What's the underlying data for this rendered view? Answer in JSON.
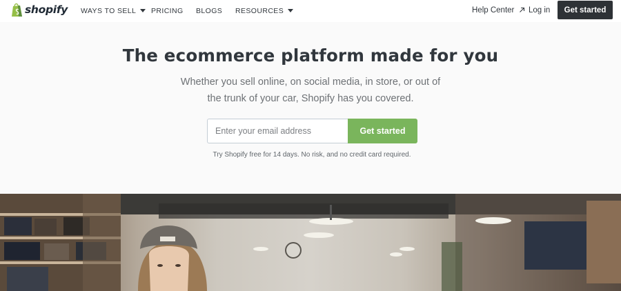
{
  "brand": {
    "name": "shopify"
  },
  "nav": {
    "items": [
      {
        "label": "WAYS TO SELL",
        "has_dropdown": true
      },
      {
        "label": "PRICING",
        "has_dropdown": false
      },
      {
        "label": "BLOGS",
        "has_dropdown": false
      },
      {
        "label": "RESOURCES",
        "has_dropdown": true
      }
    ],
    "help_center": "Help Center",
    "login": "Log in",
    "cta": "Get started"
  },
  "hero": {
    "title": "The ecommerce platform made for you",
    "subtitle": "Whether you sell online, on social media, in store, or out of the trunk of your car, Shopify has you covered.",
    "email_placeholder": "Enter your email address",
    "email_value": "",
    "submit_label": "Get started",
    "trial_note": "Try Shopify free for 14 days. No risk, and no credit card required."
  },
  "colors": {
    "accent": "#7ab55c",
    "dark": "#2e3236",
    "text": "#31373d",
    "muted": "#6d7175"
  },
  "icons": [
    "shopping-bag-icon",
    "chevron-down-icon",
    "external-link-icon"
  ]
}
